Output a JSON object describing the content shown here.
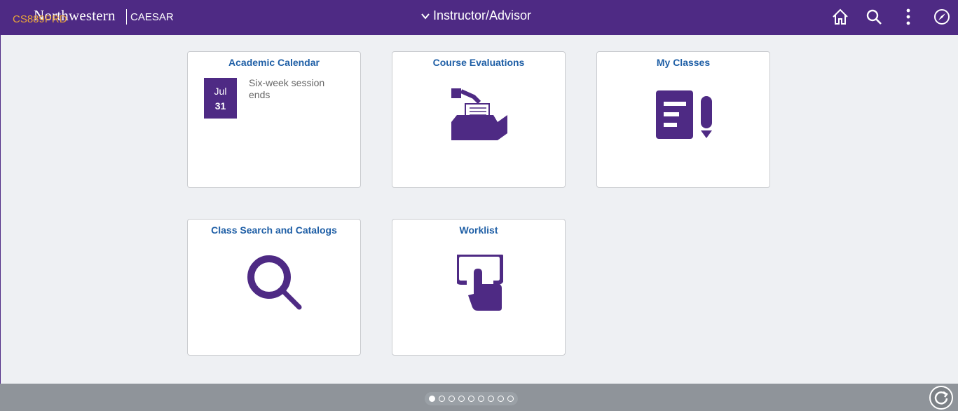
{
  "header": {
    "brand": "Northwestern",
    "brand_sub": "CAESAR",
    "env": "CS889PRD",
    "title": "Instructor/Advisor",
    "icons": [
      "home-icon",
      "search-icon",
      "actions-menu-icon",
      "navbar-compass-icon"
    ]
  },
  "tiles": [
    {
      "title": "Academic Calendar",
      "month": "Jul",
      "day": "31",
      "text": "Six-week session ends"
    },
    {
      "title": "Course Evaluations",
      "icon": "ballot-box-icon"
    },
    {
      "title": "My Classes",
      "icon": "document-pencil-icon"
    },
    {
      "title": "Class Search and Catalogs",
      "icon": "magnifier-icon"
    },
    {
      "title": "Worklist",
      "icon": "touch-screen-icon"
    }
  ],
  "pager": {
    "pages": 9,
    "active": 1
  },
  "colors": {
    "purple": "#4e2a84",
    "link": "#1f5fa6",
    "env": "#e8a33a"
  }
}
